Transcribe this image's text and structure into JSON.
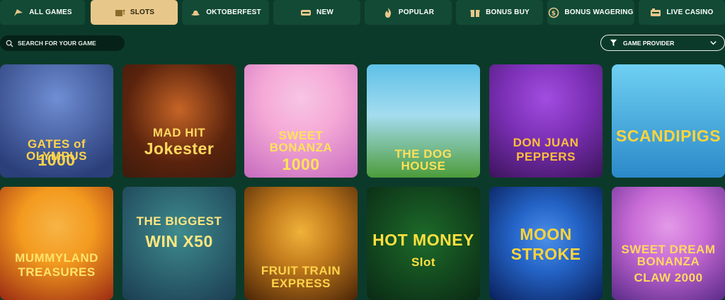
{
  "tabs": [
    {
      "label": "ALL GAMES",
      "icon": "rocket-icon",
      "active": false
    },
    {
      "label": "SLOTS",
      "icon": "slot-machine-icon",
      "active": true
    },
    {
      "label": "OKTOBERFEST",
      "icon": "hat-icon",
      "active": false
    },
    {
      "label": "NEW",
      "icon": "new-badge-icon",
      "active": false
    },
    {
      "label": "POPULAR",
      "icon": "flame-icon",
      "active": false
    },
    {
      "label": "BONUS BUY",
      "icon": "gift-icon",
      "active": false
    },
    {
      "label": "BONUS WAGERING",
      "icon": "coin-icon",
      "active": false
    },
    {
      "label": "LIVE CASINO",
      "icon": "live-badge-icon",
      "active": false
    }
  ],
  "search": {
    "placeholder": "SEARCH FOR YOUR GAME",
    "icon": "search-icon"
  },
  "provider": {
    "label": "GAME PROVIDER",
    "icon": "filter-icon",
    "chevron": "chevron-down-icon"
  },
  "games": [
    {
      "name": "gates-of-olympus-1000",
      "line1": "GATES of OLYMPUS",
      "line2": "1000",
      "bg1": "#6f8ed4",
      "bg2": "#2b3f7a",
      "color": "#ffd34a"
    },
    {
      "name": "mad-hit-jokester",
      "line1": "MAD HIT",
      "line2": "Jokester",
      "bg1": "#a0471c",
      "bg2": "#3d1b0d",
      "color": "#ffd860"
    },
    {
      "name": "sweet-bonanza-1000",
      "line1": "SWEET BONANZA",
      "line2": "1000",
      "bg1": "#f5a9d6",
      "bg2": "#c66bbf",
      "color": "#ffe35a"
    },
    {
      "name": "the-dog-house",
      "line1": "THE DOG HOUSE",
      "line2": "",
      "bg1": "#5ec1e8",
      "bg2": "#4c9c3a",
      "color": "#ffe05a"
    },
    {
      "name": "don-juan-peppers",
      "line1": "DON JUAN",
      "line2": "PEPPERS",
      "bg1": "#7a2fb4",
      "bg2": "#3d145c",
      "color": "#ffbf3a"
    },
    {
      "name": "scandipigs",
      "line1": "SCANDIPIGS",
      "line2": "",
      "bg1": "#6fd0f2",
      "bg2": "#2b89c9",
      "color": "#ffd43a"
    },
    {
      "name": "mummyland-treasures",
      "line1": "MUMMYLAND",
      "line2": "TREASURES",
      "bg1": "#f39a1f",
      "bg2": "#9b2a12",
      "color": "#ffe36a"
    },
    {
      "name": "the-biggest-win-x50",
      "line1": "THE BIGGEST",
      "line2": "WIN X50",
      "bg1": "#3e8b8e",
      "bg2": "#1b3d52",
      "color": "#ffe680"
    },
    {
      "name": "fruit-train-express",
      "line1": "FRUIT TRAIN",
      "line2": "EXPRESS",
      "bg1": "#c17a1c",
      "bg2": "#4a2407",
      "color": "#ffd34a"
    },
    {
      "name": "hot-money-slot",
      "line1": "HOT MONEY",
      "line2": "Slot",
      "bg1": "#1d6b2a",
      "bg2": "#0a2a14",
      "color": "#ffe040"
    },
    {
      "name": "moon-stroke",
      "line1": "MOON",
      "line2": "STROKE",
      "bg1": "#2464c7",
      "bg2": "#0a1f5a",
      "color": "#ffd43a"
    },
    {
      "name": "sweet-dream-bonanza-claw-2000",
      "line1": "SWEET DREAM BONANZA",
      "line2": "CLAW 2000",
      "bg1": "#c86bd6",
      "bg2": "#5b2a8a",
      "color": "#ffd860"
    }
  ]
}
